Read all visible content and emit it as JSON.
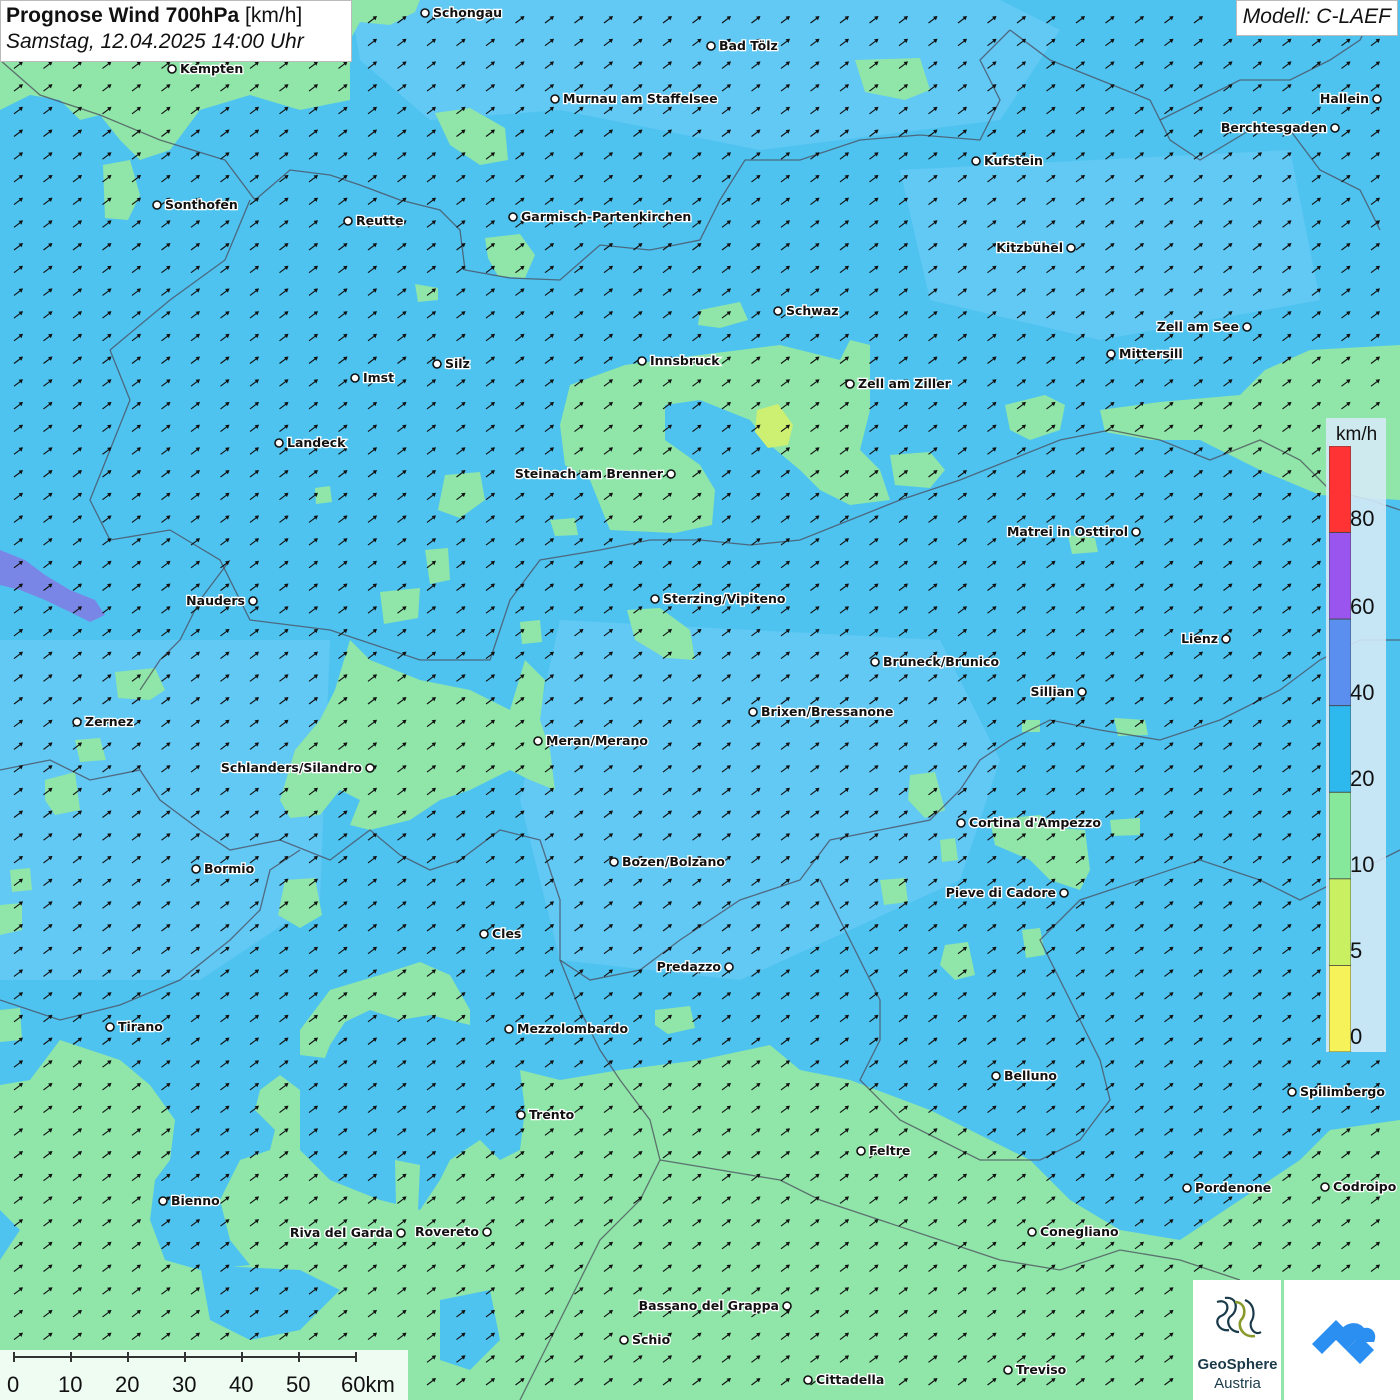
{
  "header": {
    "title_bold": "Prognose Wind 700hPa",
    "title_unit": "[km/h]",
    "datetime": "Samstag, 12.04.2025 14:00 Uhr",
    "model": "Modell: C-LAEF"
  },
  "legend": {
    "unit": "km/h",
    "ticks": [
      "80",
      "60",
      "40",
      "20",
      "10",
      "5",
      "0"
    ],
    "colors": [
      "#ff3333",
      "#9955ee",
      "#5a8ff0",
      "#2db8ee",
      "#85e89a",
      "#c8f060",
      "#f5f25a"
    ]
  },
  "map_colors": {
    "base": "#4fc3ef",
    "light_blue": "#62c8f4",
    "green": "#8fe6a8",
    "yellow_green": "#cdef72",
    "violet": "#7a86e6",
    "border": "#4a4a5a"
  },
  "cities": [
    {
      "name": "Schongau"
    },
    {
      "name": "Bad Tölz"
    },
    {
      "name": "Kempten"
    },
    {
      "name": "Murnau am Staffelsee"
    },
    {
      "name": "Hallein"
    },
    {
      "name": "Berchtesgaden"
    },
    {
      "name": "Kufstein"
    },
    {
      "name": "Sonthofen"
    },
    {
      "name": "Reutte"
    },
    {
      "name": "Garmisch-Partenkirchen"
    },
    {
      "name": "Kitzbühel"
    },
    {
      "name": "Schwaz"
    },
    {
      "name": "Zell am See"
    },
    {
      "name": "Mittersill"
    },
    {
      "name": "Innsbruck"
    },
    {
      "name": "Silz"
    },
    {
      "name": "Imst"
    },
    {
      "name": "Zell am Ziller"
    },
    {
      "name": "Landeck"
    },
    {
      "name": "Steinach am Brenner"
    },
    {
      "name": "Matrei in Osttirol"
    },
    {
      "name": "Nauders"
    },
    {
      "name": "Sterzing/Vipiteno"
    },
    {
      "name": "Lienz"
    },
    {
      "name": "Bruneck/Brunico"
    },
    {
      "name": "Sillian"
    },
    {
      "name": "Brixen/Bressanone"
    },
    {
      "name": "Zernez"
    },
    {
      "name": "Meran/Merano"
    },
    {
      "name": "Schlanders/Silandro"
    },
    {
      "name": "Cortina d'Ampezzo"
    },
    {
      "name": "Bozen/Bolzano"
    },
    {
      "name": "Bormio"
    },
    {
      "name": "Pieve di Cadore"
    },
    {
      "name": "Cles"
    },
    {
      "name": "Predazzo"
    },
    {
      "name": "Tirano"
    },
    {
      "name": "Mezzolombardo"
    },
    {
      "name": "Belluno"
    },
    {
      "name": "Spilimbergo"
    },
    {
      "name": "Trento"
    },
    {
      "name": "Feltre"
    },
    {
      "name": "Pordenone"
    },
    {
      "name": "Codroipo"
    },
    {
      "name": "Bienno"
    },
    {
      "name": "Riva del Garda"
    },
    {
      "name": "Rovereto"
    },
    {
      "name": "Conegliano"
    },
    {
      "name": "Bassano del Grappa"
    },
    {
      "name": "Schio"
    },
    {
      "name": "Treviso"
    },
    {
      "name": "Cittadella"
    }
  ],
  "scale": {
    "labels": [
      "0",
      "10",
      "20",
      "30",
      "40",
      "50",
      "60km"
    ]
  },
  "logos": [
    {
      "name": "GeoSphere Austria",
      "line1": "GeoSphere",
      "line2": "Austria",
      "color": "#1a3a4a",
      "accent": "#8a9a2a"
    },
    {
      "name": "cloud-logo",
      "color": "#2a8ff0"
    }
  ]
}
